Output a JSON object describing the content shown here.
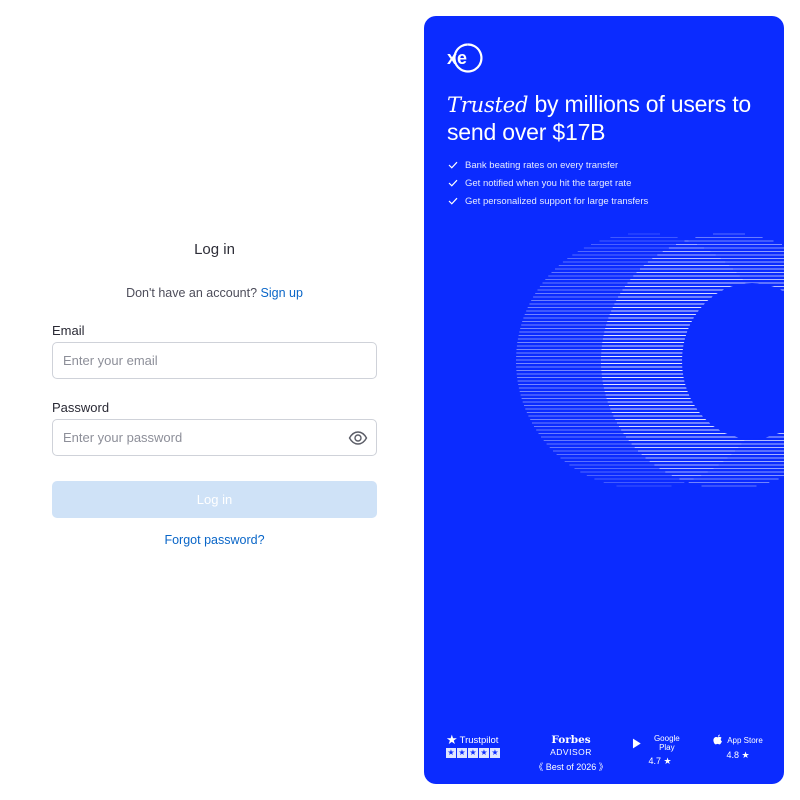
{
  "login": {
    "title": "Log in",
    "no_account_text": "Don't have an account?",
    "signup_link": "Sign up",
    "email_label": "Email",
    "email_placeholder": "Enter your email",
    "email_value": "",
    "password_label": "Password",
    "password_placeholder": "Enter your password",
    "password_value": "",
    "password_toggle_icon": "eye-icon",
    "submit_label": "Log in",
    "forgot_link": "Forgot password?"
  },
  "brand": {
    "logo_text": "xe",
    "headline_italic": "Trusted",
    "headline_rest": " by millions of users to send over $17B",
    "features": [
      "Bank beating rates on every transfer",
      "Get notified when you hit the target rate",
      "Get personalized support for large transfers"
    ],
    "badges": {
      "trustpilot": {
        "name": "Trustpilot",
        "stars": 5
      },
      "forbes": {
        "name": "Forbes",
        "suffix": "ADVISOR",
        "sub": "Best of 2026"
      },
      "google_play": {
        "name": "Google Play",
        "rating": "4.7 ★"
      },
      "app_store": {
        "name": "App Store",
        "rating": "4.8 ★"
      }
    }
  },
  "colors": {
    "panel_bg": "#0b2bff",
    "link": "#0a66c8",
    "button_disabled_bg": "#cfe2f7"
  }
}
